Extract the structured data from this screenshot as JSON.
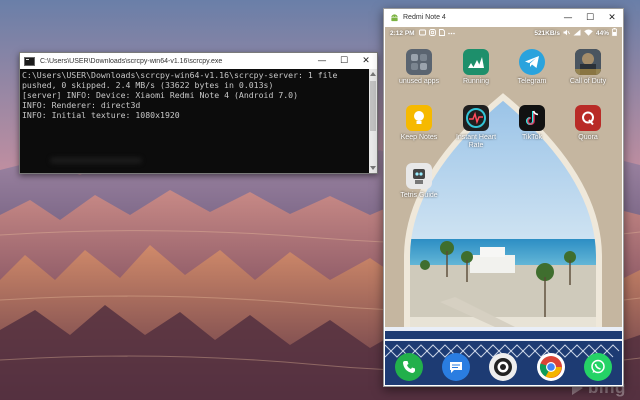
{
  "console": {
    "title": "C:\\Users\\USER\\Downloads\\scrcpy-win64-v1.16\\scrcpy.exe",
    "lines": [
      "C:\\Users\\USER\\Downloads\\scrcpy-win64-v1.16\\scrcpy-server: 1 file",
      "pushed, 0 skipped. 2.4 MB/s (33622 bytes in 0.013s)",
      "[server] INFO: Device: Xiaomi Redmi Note 4 (Android 7.0)",
      "INFO: Renderer: direct3d",
      "INFO: Initial texture: 1080x1920"
    ]
  },
  "phone": {
    "title": "Redmi Note 4",
    "status": {
      "time": "2:12 PM",
      "speed": "521KB/s",
      "battery": "44%"
    },
    "apps": [
      {
        "label": "unused apps",
        "icon": "folder-icon",
        "color": "#5a6470"
      },
      {
        "label": "Running",
        "icon": "adidas-icon",
        "color": "#1d8f6b"
      },
      {
        "label": "Telegram",
        "icon": "telegram-icon",
        "color": "#2aa3dd"
      },
      {
        "label": "Call of Duty",
        "icon": "call-of-duty-icon",
        "color": "#3b3b3b"
      },
      {
        "label": "Keep Notes",
        "icon": "keep-notes-icon",
        "color": "#f6b900"
      },
      {
        "label": "Instant Heart Rate",
        "icon": "heart-rate-icon",
        "color": "#1f1f1f"
      },
      {
        "label": "TikTok",
        "icon": "tiktok-icon",
        "color": "#111111"
      },
      {
        "label": "Quora",
        "icon": "quora-icon",
        "color": "#b92b27"
      },
      {
        "label": "Tetris Guide",
        "icon": "tetris-icon",
        "color": "#e8e8e8"
      }
    ],
    "dock": [
      {
        "name": "phone-icon",
        "color": "#22b04b"
      },
      {
        "name": "messages-icon",
        "color": "#2a7de1"
      },
      {
        "name": "camera-icon",
        "color": "#eeeeee"
      },
      {
        "name": "chrome-icon",
        "color": "#ffffff"
      },
      {
        "name": "whatsapp-icon",
        "color": "#25d366"
      }
    ]
  },
  "desktop": {
    "watermark": "bing"
  }
}
